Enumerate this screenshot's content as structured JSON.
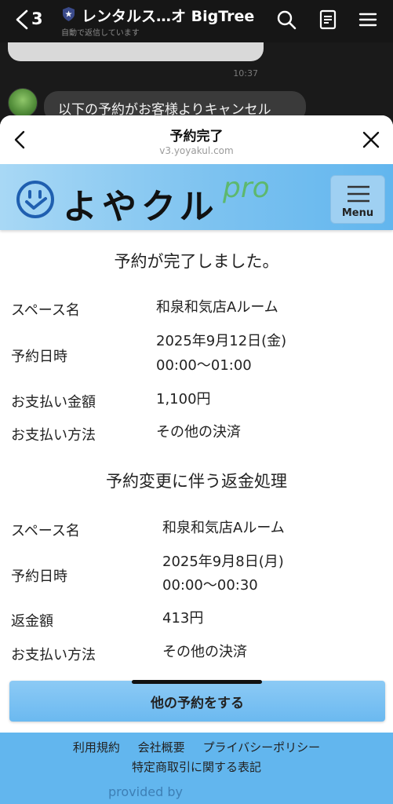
{
  "chat": {
    "back_count": "3",
    "title": "レンタルス…オ BigTree",
    "subtitle": "自動で返信しています",
    "time": "10:37",
    "message": "以下の予約がお客様よりキャンセル"
  },
  "sheet": {
    "title": "予約完了",
    "url": "v3.yoyakul.com"
  },
  "site": {
    "logo_text": "よやクル",
    "logo_pro": "pro",
    "menu_label": "Menu"
  },
  "booking": {
    "heading": "予約が完了しました。",
    "rows": [
      {
        "label": "スペース名",
        "value": "和泉和気店Aルーム",
        "value2": ""
      },
      {
        "label": "予約日時",
        "value": "2025年9月12日(金)",
        "value2": "00:00〜01:00"
      },
      {
        "label": "お支払い金額",
        "value": "1,100円",
        "value2": ""
      },
      {
        "label": "お支払い方法",
        "value": "その他の決済",
        "value2": ""
      }
    ]
  },
  "refund": {
    "heading": "予約変更に伴う返金処理",
    "rows": [
      {
        "label": "スペース名",
        "value": "和泉和気店Aルーム",
        "value2": ""
      },
      {
        "label": "予約日時",
        "value": "2025年9月8日(月)",
        "value2": "00:00〜00:30"
      },
      {
        "label": "返金額",
        "value": "413円",
        "value2": ""
      },
      {
        "label": "お支払い方法",
        "value": "その他の決済",
        "value2": ""
      }
    ]
  },
  "cta": {
    "label": "他の予約をする"
  },
  "footer": {
    "links": [
      "利用規約",
      "会社概要",
      "プライバシーポリシー"
    ],
    "link2": "特定商取引に関する表記",
    "provided": "provided by"
  },
  "colors": {
    "accent": "#62b6ee",
    "button": "#7cc2f0",
    "logo_pro": "#5db86e"
  },
  "icons": {
    "back": "chevron-left-icon",
    "verified": "shield-star-icon",
    "search": "search-icon",
    "notes": "notes-icon",
    "menu": "hamburger-menu-icon",
    "close": "close-icon",
    "logo": "smile-check-icon"
  }
}
